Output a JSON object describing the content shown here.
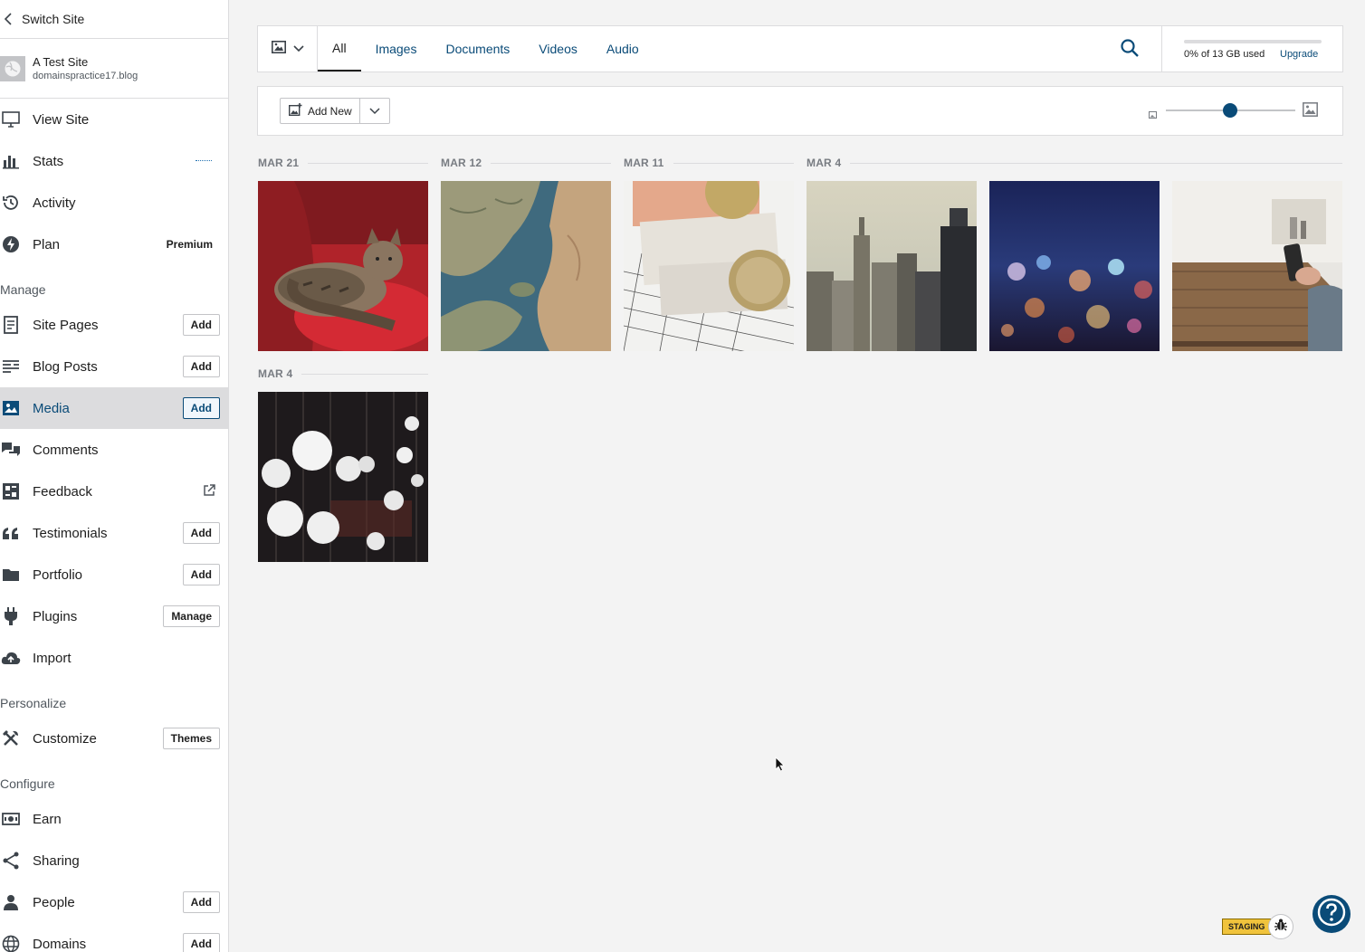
{
  "sidebar": {
    "switch_site": "Switch Site",
    "site_title": "A Test Site",
    "site_domain": "domainspractice17.blog",
    "items": {
      "view_site": "View Site",
      "stats": "Stats",
      "activity": "Activity",
      "plan": "Plan",
      "plan_badge": "Premium",
      "site_pages": "Site Pages",
      "blog_posts": "Blog Posts",
      "media": "Media",
      "comments": "Comments",
      "feedback": "Feedback",
      "testimonials": "Testimonials",
      "portfolio": "Portfolio",
      "plugins": "Plugins",
      "import": "Import",
      "customize": "Customize",
      "earn": "Earn",
      "sharing": "Sharing",
      "people": "People",
      "domains": "Domains"
    },
    "sections": {
      "manage": "Manage",
      "personalize": "Personalize",
      "configure": "Configure"
    },
    "buttons": {
      "add": "Add",
      "manage": "Manage",
      "themes": "Themes"
    }
  },
  "filter": {
    "tabs": [
      "All",
      "Images",
      "Documents",
      "Videos",
      "Audio"
    ],
    "active_tab": "All",
    "storage_used_text": "0% of 13 GB used",
    "storage_used_fraction": 0,
    "upgrade": "Upgrade"
  },
  "toolbar": {
    "add_new": "Add New",
    "zoom_level_fraction": 0.5
  },
  "groups": [
    {
      "date": "MAR 21"
    },
    {
      "date": "MAR 12"
    },
    {
      "date": "MAR 11"
    },
    {
      "date": "MAR 4"
    },
    {
      "date": "MAR 4"
    }
  ],
  "media_items": [
    {
      "subject": "cat on red sofa"
    },
    {
      "subject": "fantasy map"
    },
    {
      "subject": "euro banknotes and coins"
    },
    {
      "subject": "city skyline"
    },
    {
      "subject": "bokeh city lights"
    },
    {
      "subject": "phone on wooden table"
    },
    {
      "subject": "hanging light bulbs"
    }
  ],
  "footer": {
    "staging": "STAGING"
  },
  "colors": {
    "accent": "#0a4b78",
    "link": "#2271b1",
    "sidebar_active": "#dcdcde",
    "staging": "#f0c33c"
  }
}
